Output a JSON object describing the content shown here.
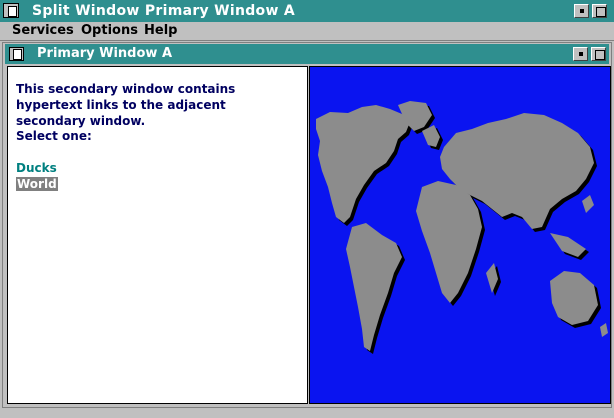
{
  "window": {
    "title": "Split Window Primary Window A"
  },
  "menu": {
    "items": [
      "Services",
      "Options",
      "Help"
    ]
  },
  "inner_window": {
    "title": "Primary Window A"
  },
  "left_pane": {
    "description": "This secondary window contains hypertext links to the adjacent secondary window.",
    "prompt": "Select one:",
    "links": [
      "Ducks",
      "World"
    ]
  },
  "right_pane": {
    "image": "world-map",
    "background_color": "#0a14f0",
    "land_color": "#8c8c8c"
  },
  "colors": {
    "titlebar": "#2f8f8f",
    "text_dark_blue": "#000060",
    "link_teal": "#008080"
  }
}
